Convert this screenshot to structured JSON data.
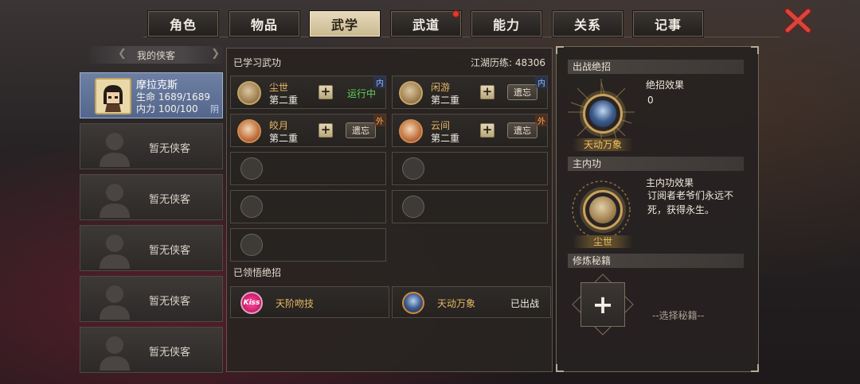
{
  "tabs": [
    {
      "label": "角色"
    },
    {
      "label": "物品"
    },
    {
      "label": "武学"
    },
    {
      "label": "武道"
    },
    {
      "label": "能力"
    },
    {
      "label": "关系"
    },
    {
      "label": "记事"
    }
  ],
  "active_tab": "武学",
  "heroes": {
    "header": "我的侠客",
    "selected": {
      "name": "摩拉克斯",
      "hp_label": "生命",
      "hp": "1689/1689",
      "mp_label": "内力",
      "mp": "100/100",
      "yinyang": "阴"
    },
    "empty_label": "暂无侠客"
  },
  "learned": {
    "title": "已学习武功",
    "exp_label": "江湖历练:",
    "exp_value": "48306",
    "skills": [
      {
        "name": "尘世",
        "level": "第二重",
        "status": "运行中",
        "tag": "内"
      },
      {
        "name": "闲游",
        "level": "第二重",
        "action": "遗忘",
        "tag": "内"
      },
      {
        "name": "皎月",
        "level": "第二重",
        "action": "遗忘",
        "tag": "外"
      },
      {
        "name": "云间",
        "level": "第二重",
        "action": "遗忘",
        "tag": "外"
      }
    ],
    "plus": "+"
  },
  "ultimates": {
    "title": "已领悟绝招",
    "items": [
      {
        "name": "天阶吻技",
        "icon_text": "Kiss"
      },
      {
        "name": "天动万象",
        "status": "已出战"
      }
    ]
  },
  "right": {
    "combat_title": "出战绝招",
    "combat_name": "天动万象",
    "combat_effect_label": "绝招效果",
    "combat_effect_value": "0",
    "main_title": "主内功",
    "main_name": "尘世",
    "main_effect_label": "主内功效果",
    "main_effect_text": "订阅者老爷们永远不死，获得永生。",
    "book_title": "修炼秘籍",
    "book_plus": "+",
    "book_placeholder": "--选择秘籍--"
  },
  "colors": {
    "accent_gold": "#e6b763",
    "running_green": "#5fd45a",
    "tab_active": "#e6d9bb",
    "close_red": "#c9312b"
  }
}
